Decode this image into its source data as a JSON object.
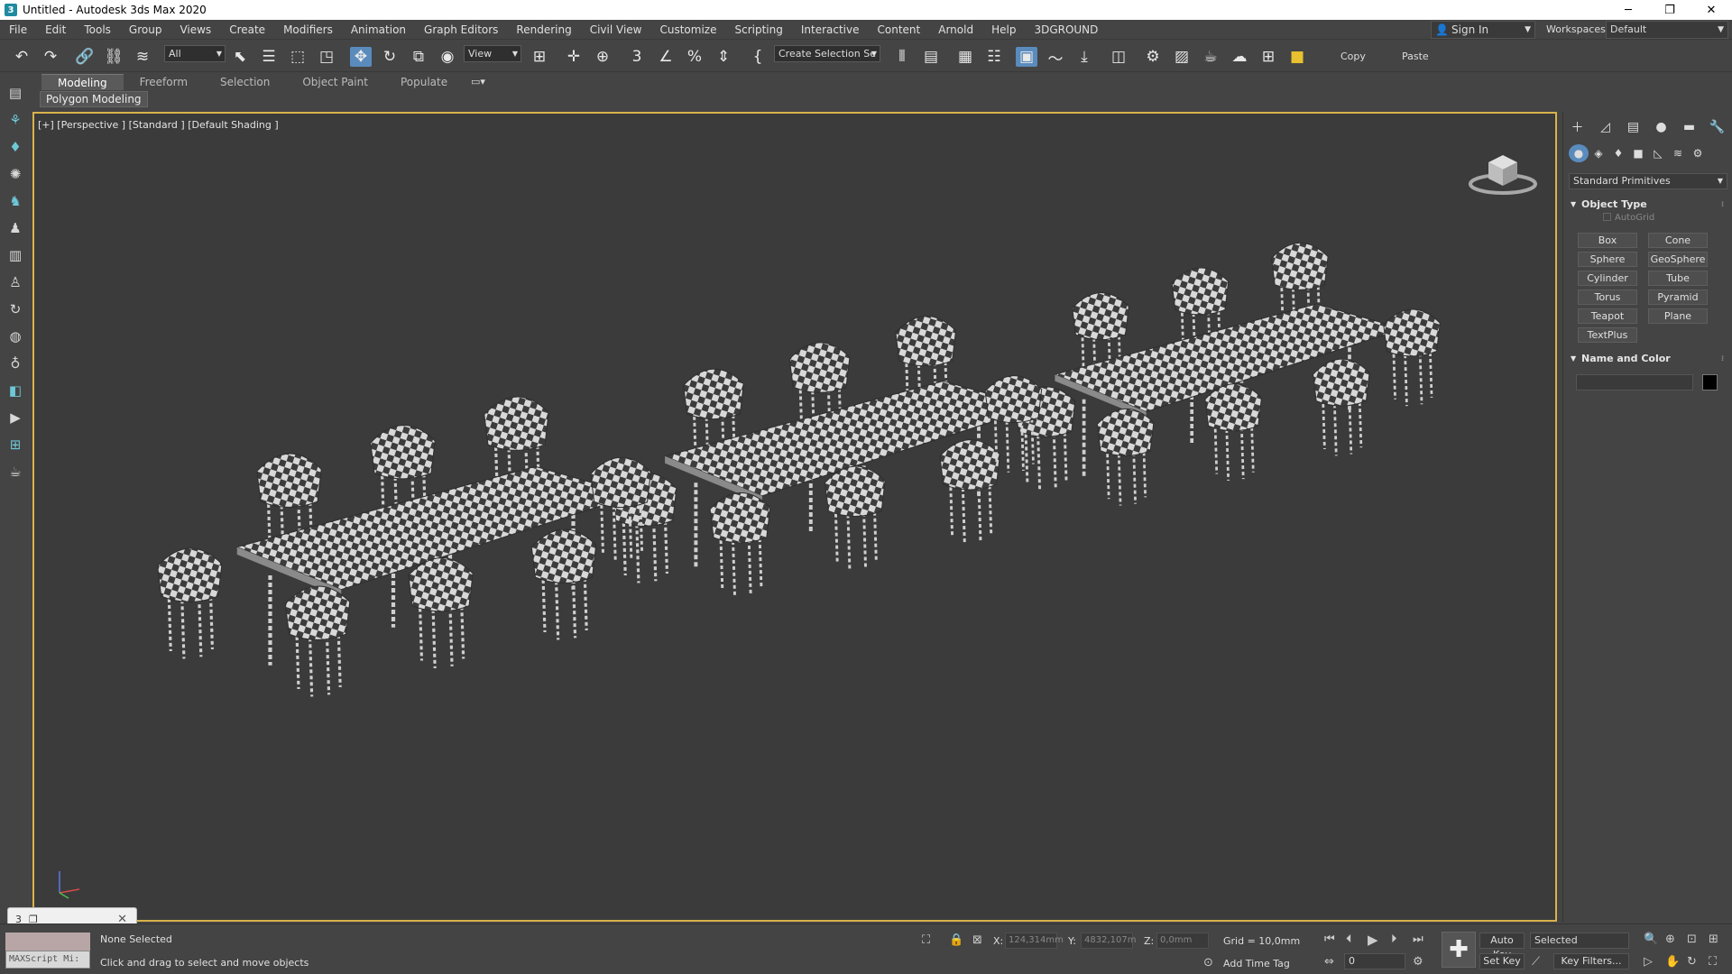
{
  "window": {
    "title": "Untitled - Autodesk 3ds Max 2020",
    "app_icon": "3",
    "minimize": "─",
    "maximize": "❐",
    "close": "✕"
  },
  "menu": [
    "File",
    "Edit",
    "Tools",
    "Group",
    "Views",
    "Create",
    "Modifiers",
    "Animation",
    "Graph Editors",
    "Rendering",
    "Civil View",
    "Customize",
    "Scripting",
    "Interactive",
    "Content",
    "Arnold",
    "Help",
    "3DGROUND"
  ],
  "account": {
    "signin_label": "Sign In",
    "workspaces_label": "Workspaces:",
    "workspace_value": "Default"
  },
  "toolbar": {
    "selection_filter": "All",
    "reference_coord": "View",
    "named_selection": "Create Selection Se",
    "copy_label": "Copy",
    "paste_label": "Paste"
  },
  "ribbon": {
    "tabs": [
      "Modeling",
      "Freeform",
      "Selection",
      "Object Paint",
      "Populate"
    ],
    "active_tab": "Modeling",
    "panel_label": "Polygon Modeling"
  },
  "viewport": {
    "label": "[+] [Perspective ] [Standard ] [Default Shading ]"
  },
  "command_panel": {
    "category": "Standard Primitives",
    "object_type_title": "Object Type",
    "autogrid_label": "AutoGrid",
    "primitives": [
      "Box",
      "Cone",
      "Sphere",
      "GeoSphere",
      "Cylinder",
      "Tube",
      "Torus",
      "Pyramid",
      "Teapot",
      "Plane",
      "TextPlus"
    ],
    "name_color_title": "Name and Color",
    "object_color": "#000000"
  },
  "status": {
    "maxscript_text": "MAXScript Mi:",
    "selection": "None Selected",
    "prompt": "Click and drag to select and move objects",
    "x_label": "X:",
    "x_value": "124,314mm",
    "y_label": "Y:",
    "y_value": "4832,107m",
    "z_label": "Z:",
    "z_value": "0,0mm",
    "grid": "Grid = 10,0mm",
    "add_time_tag": "Add Time Tag",
    "auto_key": "Auto Key",
    "set_key": "Set Key",
    "key_mode": "Selected",
    "key_filters": "Key Filters...",
    "frame": "0"
  },
  "colors": {
    "accent": "#5a8bbd",
    "viewport_border": "#d9b24a",
    "viewport_bg": "#3b3b3b",
    "ui_bg": "#444444"
  }
}
